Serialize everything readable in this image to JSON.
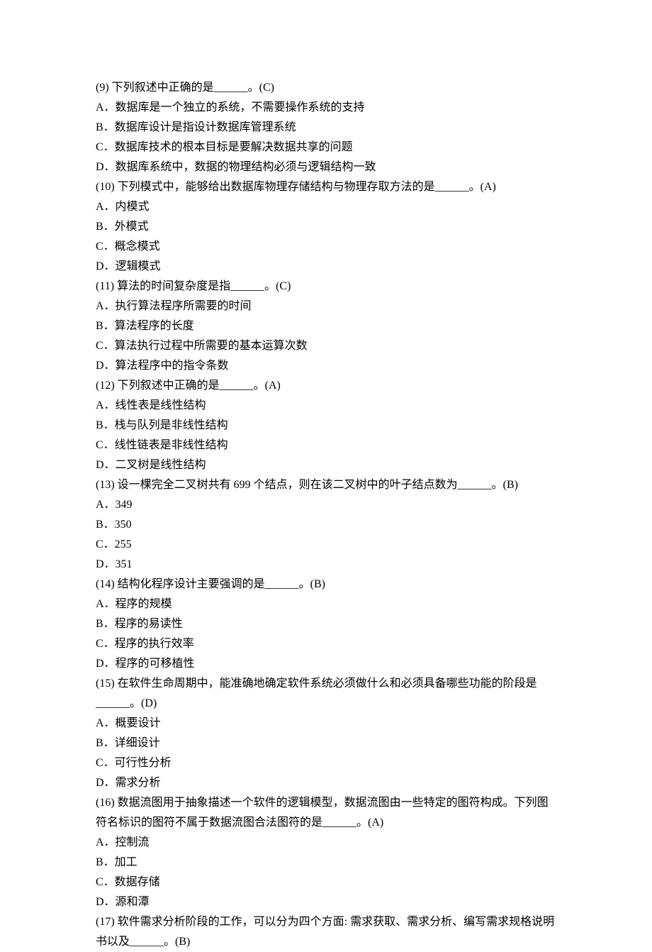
{
  "questions": [
    {
      "stem": "(9) 下列叙述中正确的是______。(C)",
      "options": [
        "A．数据库是一个独立的系统，不需要操作系统的支持",
        "B．数据库设计是指设计数据库管理系统",
        "C．数据库技术的根本目标是要解决数据共享的问题",
        "D．数据库系统中，数据的物理结构必须与逻辑结构一致"
      ]
    },
    {
      "stem": "(10) 下列模式中，能够给出数据库物理存储结构与物理存取方法的是______。(A)",
      "options": [
        "A．内模式",
        "B．外模式",
        "C．概念模式",
        "D．逻辑模式"
      ]
    },
    {
      "stem": "(11) 算法的时间复杂度是指______。(C)",
      "options": [
        "A．执行算法程序所需要的时间",
        "B．算法程序的长度",
        "C．算法执行过程中所需要的基本运算次数",
        "D．算法程序中的指令条数"
      ]
    },
    {
      "stem": "(12) 下列叙述中正确的是______。(A)",
      "options": [
        "A．线性表是线性结构",
        "B．栈与队列是非线性结构",
        "C．线性链表是非线性结构",
        "D．二叉树是线性结构"
      ]
    },
    {
      "stem": "(13) 设一棵完全二叉树共有 699 个结点，则在该二叉树中的叶子结点数为______。(B)",
      "options": [
        "A．349",
        "B．350",
        "C．255",
        "D．351"
      ]
    },
    {
      "stem": "(14) 结构化程序设计主要强调的是______。(B)",
      "options": [
        "A．程序的规模",
        "B．程序的易读性",
        "C．程序的执行效率",
        "D．程序的可移植性"
      ]
    },
    {
      "stem": "(15) 在软件生命周期中，能准确地确定软件系统必须做什么和必须具备哪些功能的阶段是______。(D)",
      "options": [
        "A．概要设计",
        "B．详细设计",
        "C．可行性分析",
        "D．需求分析"
      ]
    },
    {
      "stem": "(16) 数据流图用于抽象描述一个软件的逻辑模型，数据流图由一些特定的图符构成。下列图符名标识的图符不属于数据流图合法图符的是______。(A)",
      "options": [
        "A．控制流",
        "B．加工",
        "C．数据存储",
        "D．源和潭"
      ]
    },
    {
      "stem": "(17) 软件需求分析阶段的工作，可以分为四个方面: 需求获取、需求分析、编写需求规格说明书以及______。(B)",
      "options": []
    }
  ]
}
